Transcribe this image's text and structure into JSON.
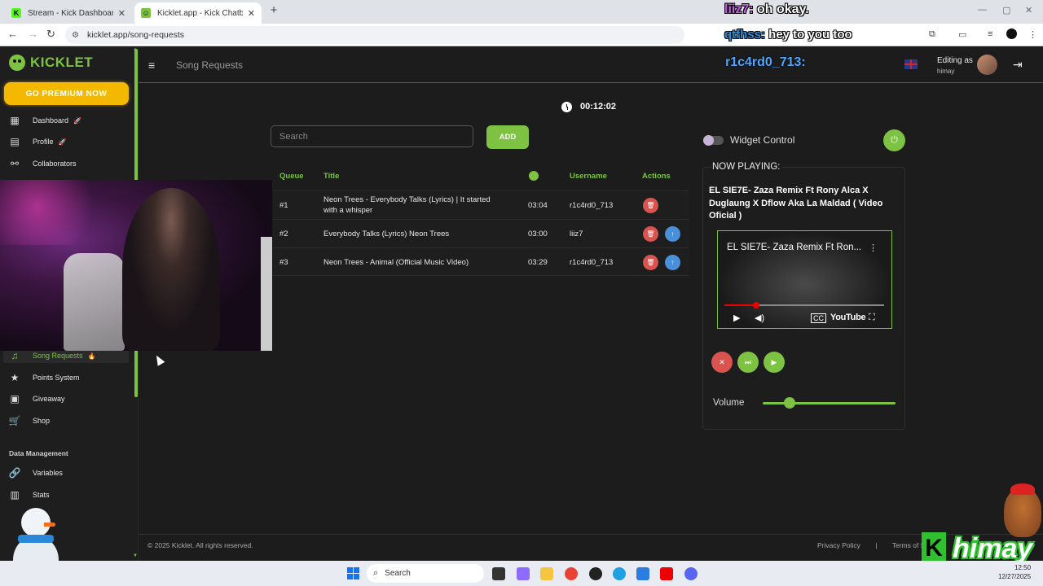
{
  "browser": {
    "tabs": [
      {
        "title": "Stream - Kick Dashboard",
        "active": false
      },
      {
        "title": "Kicklet.app - Kick Chatbot",
        "active": true
      }
    ],
    "url": "kicklet.app/song-requests"
  },
  "sidebar": {
    "logo": "KICKLET",
    "premium": "GO PREMIUM NOW",
    "items": [
      {
        "label": "Dashboard",
        "icon": "dashboard-icon",
        "badge": "🚀"
      },
      {
        "label": "Profile",
        "icon": "profile-icon",
        "badge": "🚀"
      },
      {
        "label": "Collaborators",
        "icon": "collaborators-icon"
      },
      {
        "label": "Song Requests",
        "icon": "music-icon",
        "badge": "🔥",
        "active": true
      },
      {
        "label": "Points System",
        "icon": "star-icon"
      },
      {
        "label": "Giveaway",
        "icon": "gift-icon"
      },
      {
        "label": "Shop",
        "icon": "cart-icon"
      }
    ],
    "section_data": "Data Management",
    "data_items": [
      {
        "label": "Variables",
        "icon": "link-icon"
      },
      {
        "label": "Stats",
        "icon": "chart-icon"
      }
    ]
  },
  "topbar": {
    "page_title": "Song Requests",
    "chat_name": "r1c4rd0_713:",
    "editing_as": "Editing as",
    "editing_user": "himay"
  },
  "main": {
    "timer": "00:12:02",
    "search_placeholder": "Search",
    "add_label": "ADD",
    "columns": {
      "queue": "Queue",
      "title": "Title",
      "username": "Username",
      "actions": "Actions"
    },
    "rows": [
      {
        "queue": "#1",
        "title": "Neon Trees - Everybody Talks (Lyrics) | It started with a whisper",
        "duration": "03:04",
        "username": "r1c4rd0_713",
        "can_promote": false
      },
      {
        "queue": "#2",
        "title": "Everybody Talks (Lyrics) Neon Trees",
        "duration": "03:00",
        "username": "liiz7",
        "can_promote": true
      },
      {
        "queue": "#3",
        "title": "Neon Trees - Animal (Official Music Video)",
        "duration": "03:29",
        "username": "r1c4rd0_713",
        "can_promote": true
      }
    ]
  },
  "player": {
    "widget_control": "Widget Control",
    "now_playing_label": "NOW PLAYING:",
    "now_playing_title": "EL SIE7E- Zaza Remix Ft Rony Alca X Duglaung X Dflow Aka La Maldad ( Video Oficial )",
    "video_title": "EL SIE7E- Zaza Remix Ft Ron...",
    "video_brand": "YouTube",
    "video_progress": 0.2,
    "volume_label": "Volume",
    "volume": 0.2
  },
  "footer": {
    "copyright": "© 2025 Kicklet. All rights reserved.",
    "privacy": "Privacy Policy",
    "separator": "|",
    "terms": "Terms of S"
  },
  "overlay": {
    "chat1_user": "liiz7:",
    "chat1_text": " oh okay.",
    "chat2_user": "qtfhss:",
    "chat2_text": " hey to you too",
    "streamer_logo": "himay",
    "streamer_k": "K"
  },
  "taskbar": {
    "search": "Search",
    "time": "12:50",
    "date": "12/27/2025"
  },
  "colors": {
    "accent": "#7dc242",
    "danger": "#d9534f",
    "info": "#4a90d9",
    "premium": "#f5b800"
  }
}
